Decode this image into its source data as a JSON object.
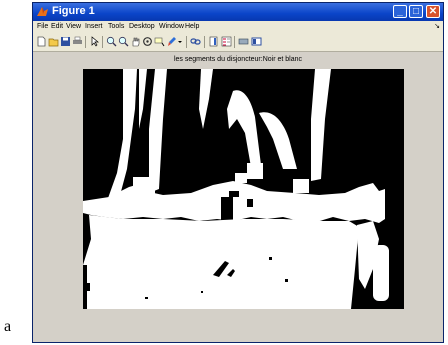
{
  "window": {
    "title": "Figure 1",
    "controls": {
      "minimize": "_",
      "maximize": "□",
      "close": "✕"
    }
  },
  "menu": [
    "File",
    "Edit",
    "View",
    "Insert",
    "Tools",
    "Desktop",
    "Window",
    "Help"
  ],
  "toolbar_icons": [
    "new-file-icon",
    "open-folder-icon",
    "save-icon",
    "print-icon",
    "edit-plot-arrow-icon",
    "zoom-in-icon",
    "zoom-out-icon",
    "pan-hand-icon",
    "rotate-3d-icon",
    "data-cursor-icon",
    "brush-icon",
    "link-icon",
    "colorbar-icon",
    "legend-icon",
    "hide-plot-tools-icon",
    "show-plot-tools-icon"
  ],
  "plot": {
    "title": "les segments du disjoncteur:Noir et blanc",
    "image_type": "binary black-and-white"
  },
  "caption_letter": "a",
  "colors": {
    "titlebar": "#0a44c8",
    "window_bg": "#d4d0c8",
    "close_button": "#d9532c"
  }
}
